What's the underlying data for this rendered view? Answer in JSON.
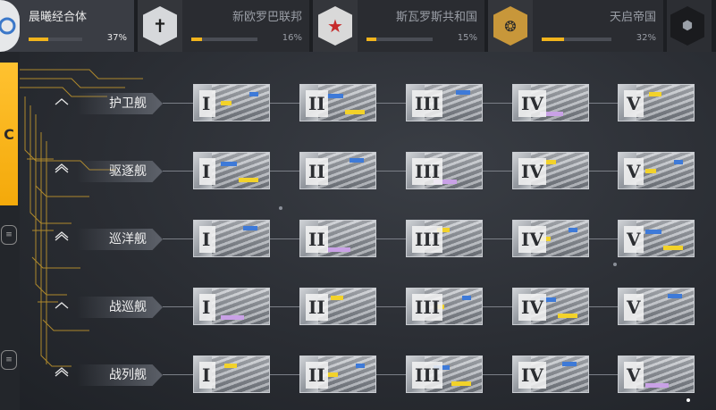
{
  "factions": [
    {
      "id": "f1",
      "name": "晨曦经合体",
      "percent": "37%",
      "progress": 0.37,
      "active": true,
      "emblem": "circle-logo-icon"
    },
    {
      "id": "f2",
      "name": "新欧罗巴联邦",
      "percent": "16%",
      "progress": 0.16,
      "active": false,
      "emblem": "cross-shield-icon"
    },
    {
      "id": "f3",
      "name": "斯瓦罗斯共和国",
      "percent": "15%",
      "progress": 0.15,
      "active": false,
      "emblem": "red-star-icon"
    },
    {
      "id": "f4",
      "name": "天启帝国",
      "percent": "32%",
      "progress": 0.32,
      "active": false,
      "emblem": "gold-circles-icon"
    },
    {
      "id": "f5",
      "name": "",
      "percent": "",
      "progress": null,
      "active": false,
      "emblem": "hex-cube-icon"
    }
  ],
  "rows": [
    {
      "label": "护卫舰",
      "rank": "chevron-1-icon",
      "tiers": [
        "I",
        "II",
        "III",
        "IV",
        "V"
      ]
    },
    {
      "label": "驱逐舰",
      "rank": "chevron-2-icon",
      "tiers": [
        "I",
        "II",
        "III",
        "IV",
        "V"
      ]
    },
    {
      "label": "巡洋舰",
      "rank": "chevron-3-icon",
      "tiers": [
        "I",
        "II",
        "III",
        "IV",
        "V"
      ]
    },
    {
      "label": "战巡舰",
      "rank": "arch-icon",
      "tiers": [
        "I",
        "II",
        "III",
        "IV",
        "V"
      ]
    },
    {
      "label": "战列舰",
      "rank": "double-arch-icon",
      "tiers": [
        "I",
        "II",
        "III",
        "IV",
        "V"
      ]
    }
  ],
  "colors": {
    "accent": "#f4b01a",
    "blue": "#3e7ad8",
    "yellow": "#f2d22a"
  }
}
